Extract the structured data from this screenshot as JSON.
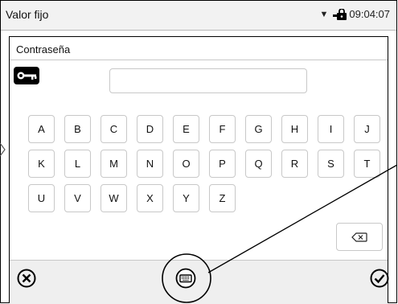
{
  "statusbar": {
    "title": "Valor fijo",
    "time": "09:04:07",
    "dropdown_icon": "triangle-down-icon",
    "lock_icon": "lock-icon"
  },
  "dialog": {
    "title": "Contraseña",
    "key_icon": "key-icon",
    "password_value": "",
    "keys_row1": [
      "A",
      "B",
      "C",
      "D",
      "E",
      "F",
      "G",
      "H",
      "I",
      "J"
    ],
    "keys_row2": [
      "K",
      "L",
      "M",
      "N",
      "O",
      "P",
      "Q",
      "R",
      "S",
      "T"
    ],
    "keys_row3": [
      "U",
      "V",
      "W",
      "X",
      "Y",
      "Z"
    ],
    "backspace_icon": "backspace-icon"
  },
  "bottom": {
    "cancel_icon": "cancel-icon",
    "keyboard_icon": "keyboard-icon",
    "confirm_icon": "checkmark-icon"
  }
}
